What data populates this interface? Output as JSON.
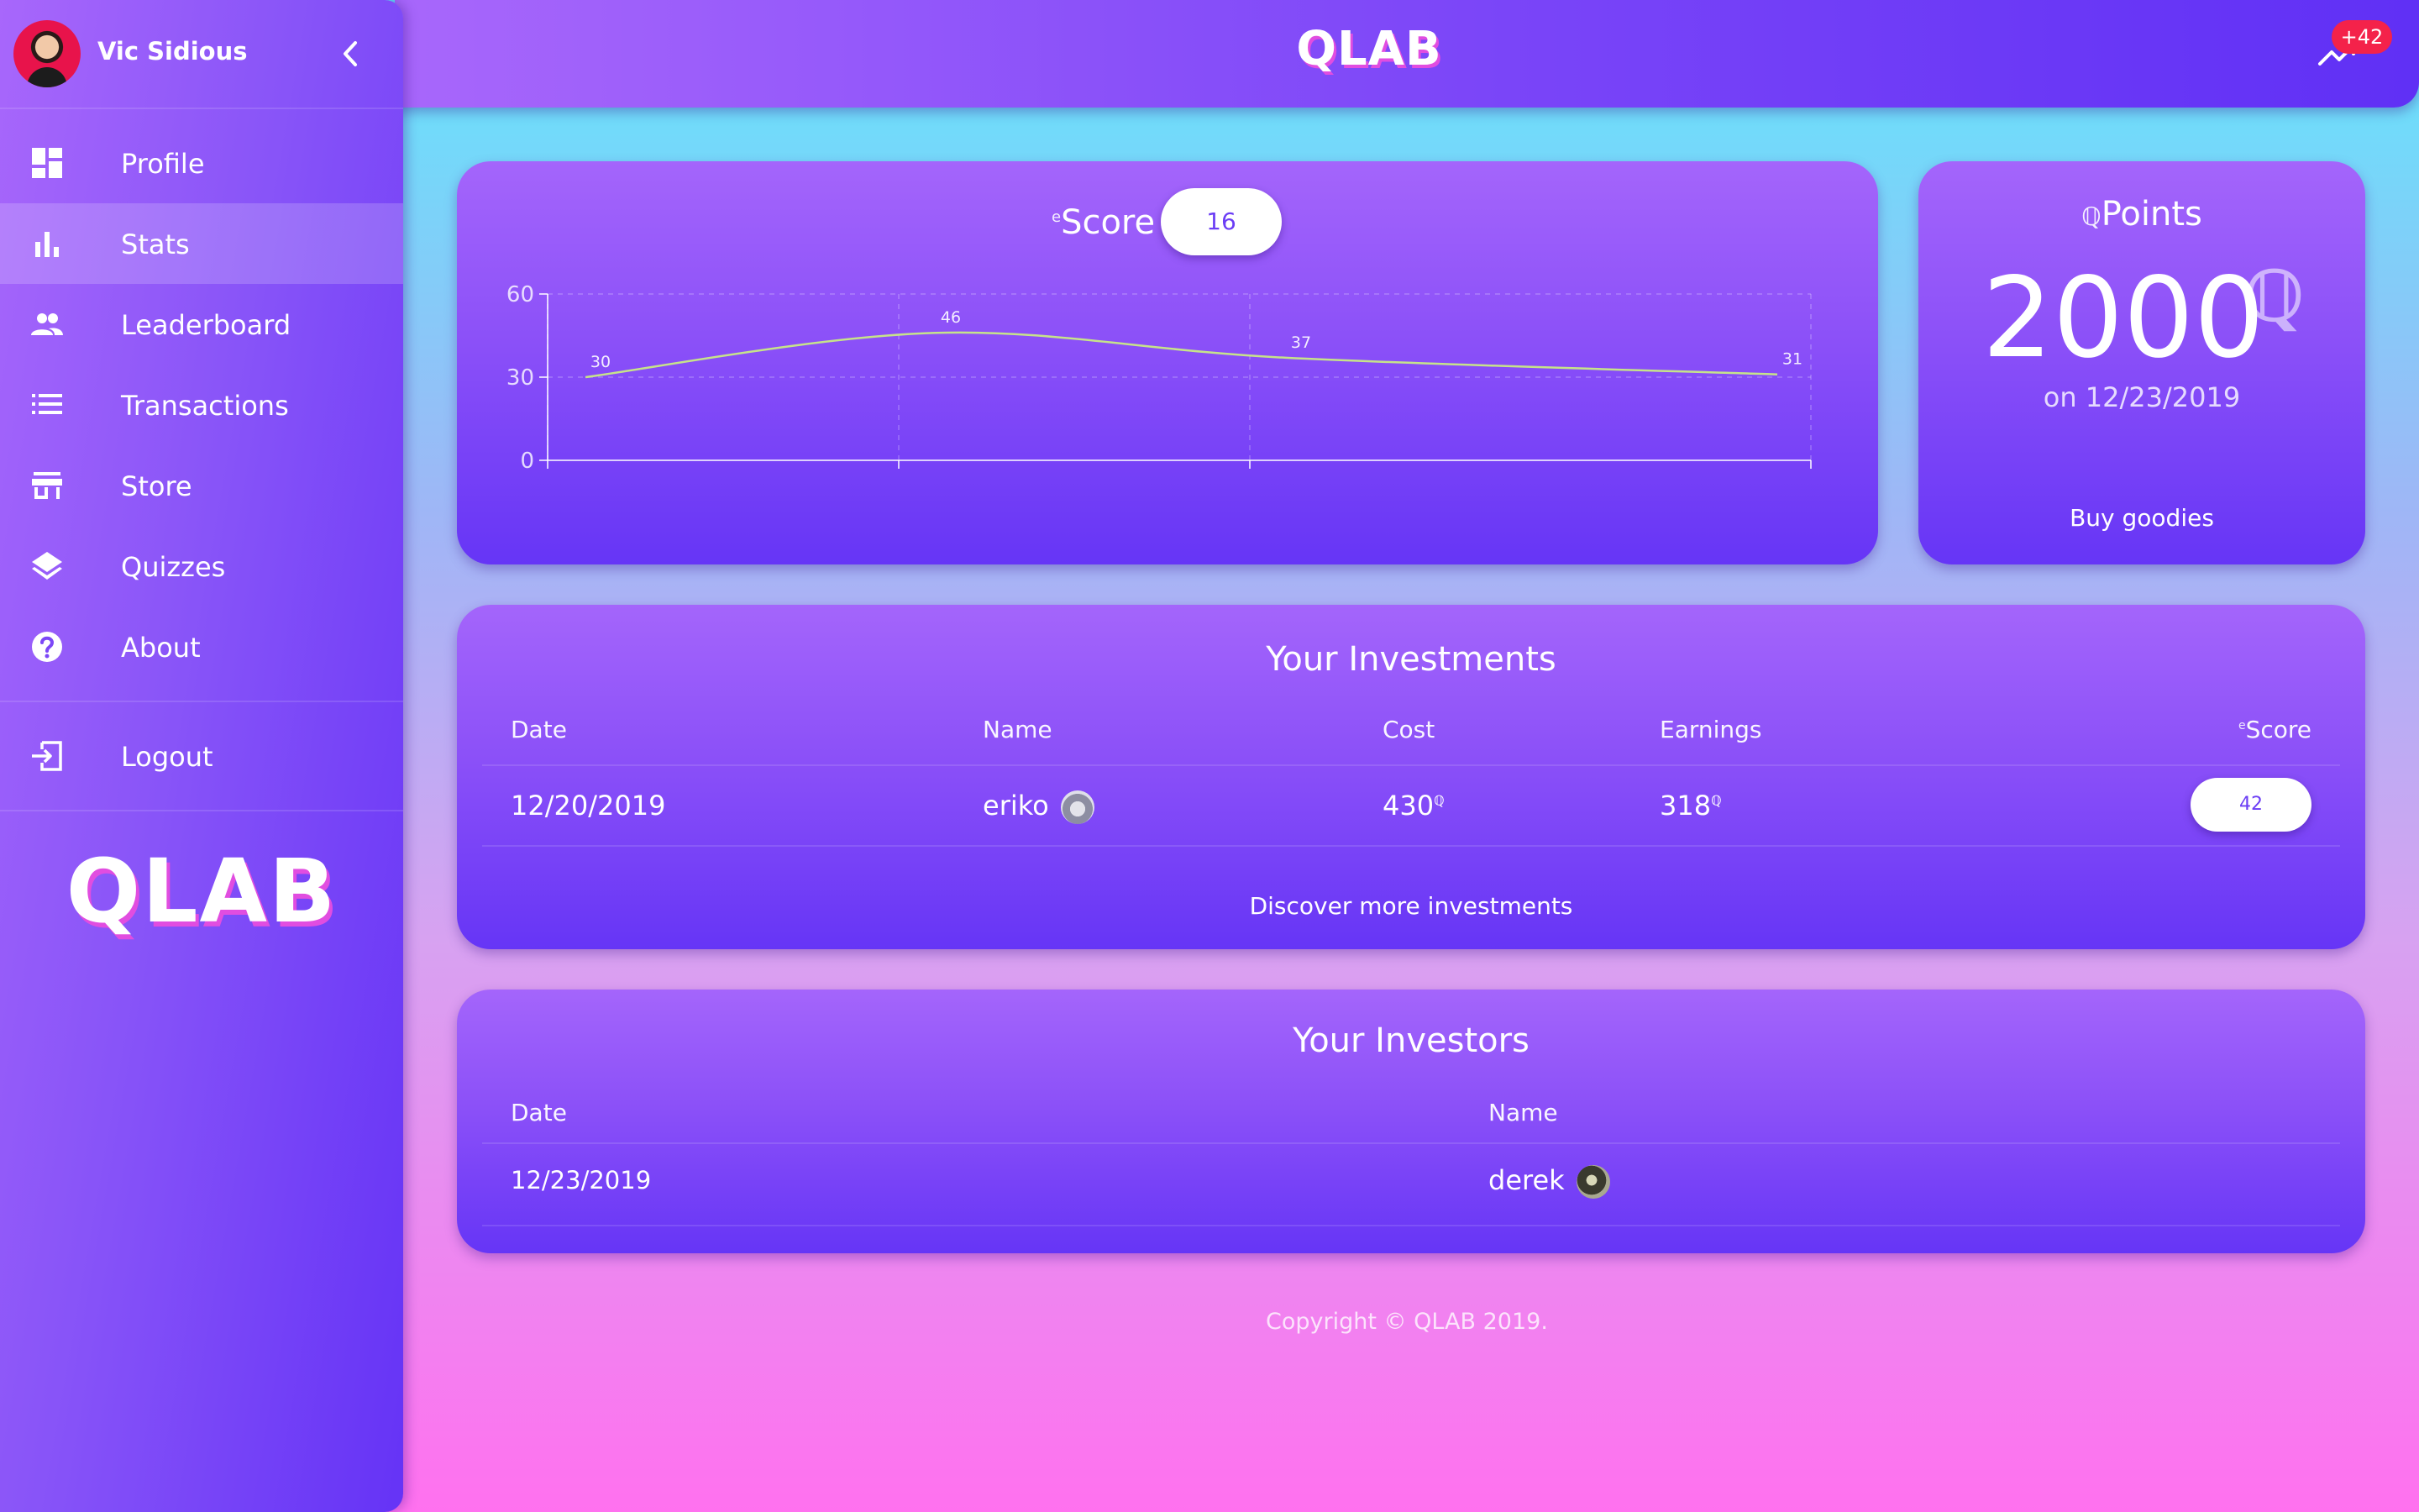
{
  "user": {
    "name": "Vic Sidious"
  },
  "nav": {
    "items": [
      {
        "label": "Profile",
        "icon": "dashboard-icon"
      },
      {
        "label": "Stats",
        "icon": "bar-chart-icon",
        "active": true
      },
      {
        "label": "Leaderboard",
        "icon": "people-icon"
      },
      {
        "label": "Transactions",
        "icon": "list-icon"
      },
      {
        "label": "Store",
        "icon": "store-icon"
      },
      {
        "label": "Quizzes",
        "icon": "layers-icon"
      },
      {
        "label": "About",
        "icon": "help-circle-icon"
      }
    ],
    "logout": "Logout"
  },
  "brand": {
    "logo": "QLAB"
  },
  "topbar": {
    "badge": "+42"
  },
  "score": {
    "prefix": "e",
    "title": "Score",
    "value": "16"
  },
  "chart_data": {
    "type": "line",
    "x": [
      1,
      2,
      3,
      4
    ],
    "values": [
      30,
      46,
      37,
      31
    ],
    "data_labels": [
      "30",
      "46",
      "37",
      "31"
    ],
    "yticks": [
      "60",
      "30",
      "0"
    ],
    "ylim": [
      0,
      60
    ],
    "grid": true,
    "line_color": "#c6e38a"
  },
  "points": {
    "prefix": "ℚ",
    "title": "Points",
    "value": "2000",
    "suffix": "ℚ",
    "date": "on 12/23/2019",
    "link": "Buy goodies"
  },
  "investments": {
    "title": "Your Investments",
    "headers": {
      "date": "Date",
      "name": "Name",
      "cost": "Cost",
      "earnings": "Earnings",
      "score_prefix": "e",
      "score": "Score"
    },
    "rows": [
      {
        "date": "12/20/2019",
        "name": "eriko",
        "cost": "430",
        "earnings": "318",
        "currency": "ℚ",
        "score": "42"
      }
    ],
    "link": "Discover more investments"
  },
  "investors": {
    "title": "Your Investors",
    "headers": {
      "date": "Date",
      "name": "Name"
    },
    "rows": [
      {
        "date": "12/23/2019",
        "name": "derek"
      }
    ]
  },
  "footer": "Copyright © QLAB 2019."
}
